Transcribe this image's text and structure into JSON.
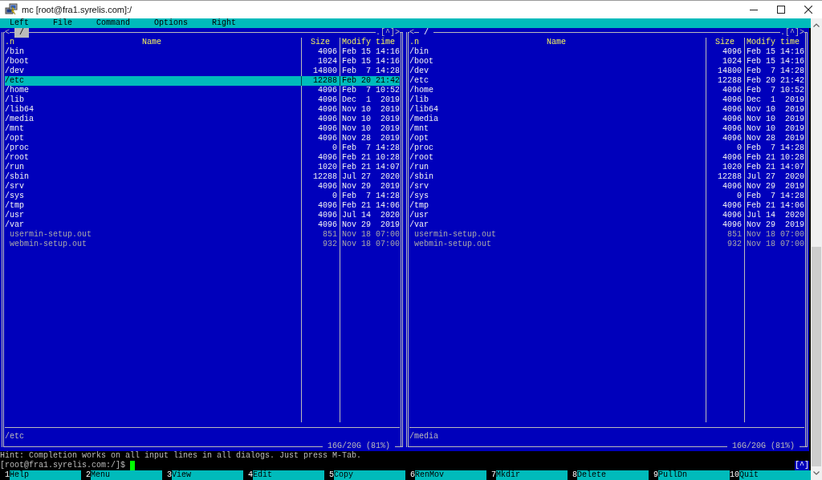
{
  "window": {
    "title": "mc [root@fra1.syrelis.com]:/"
  },
  "menu_bar": [
    "Left",
    "File",
    "Command",
    "Options",
    "Right"
  ],
  "panels": [
    {
      "active": true,
      "history_back": "<",
      "path": "/",
      "hidden_toggle": ".",
      "history_list": "[^]",
      "history_forward": ">",
      "columns": {
        "sort_indicator": ".n",
        "name": "Name",
        "size": "Size",
        "modify_time": "Modify time"
      },
      "rows": [
        {
          "kind": "directory",
          "name": "/bin",
          "size": "4096",
          "modify_time": "Feb 15 14:16",
          "selected": false
        },
        {
          "kind": "directory",
          "name": "/boot",
          "size": "1024",
          "modify_time": "Feb 15 14:16",
          "selected": false
        },
        {
          "kind": "directory",
          "name": "/dev",
          "size": "14800",
          "modify_time": "Feb  7 14:28",
          "selected": false
        },
        {
          "kind": "directory",
          "name": "/etc",
          "size": "12288",
          "modify_time": "Feb 20 21:42",
          "selected": true
        },
        {
          "kind": "directory",
          "name": "/home",
          "size": "4096",
          "modify_time": "Feb  7 10:52",
          "selected": false
        },
        {
          "kind": "directory",
          "name": "/lib",
          "size": "4096",
          "modify_time": "Dec  1  2019",
          "selected": false
        },
        {
          "kind": "directory",
          "name": "/lib64",
          "size": "4096",
          "modify_time": "Nov 10  2019",
          "selected": false
        },
        {
          "kind": "directory",
          "name": "/media",
          "size": "4096",
          "modify_time": "Nov 10  2019",
          "selected": false
        },
        {
          "kind": "directory",
          "name": "/mnt",
          "size": "4096",
          "modify_time": "Nov 10  2019",
          "selected": false
        },
        {
          "kind": "directory",
          "name": "/opt",
          "size": "4096",
          "modify_time": "Nov 28  2019",
          "selected": false
        },
        {
          "kind": "directory",
          "name": "/proc",
          "size": "0",
          "modify_time": "Feb  7 14:28",
          "selected": false
        },
        {
          "kind": "directory",
          "name": "/root",
          "size": "4096",
          "modify_time": "Feb 21 10:28",
          "selected": false
        },
        {
          "kind": "directory",
          "name": "/run",
          "size": "1020",
          "modify_time": "Feb 21 14:07",
          "selected": false
        },
        {
          "kind": "directory",
          "name": "/sbin",
          "size": "12288",
          "modify_time": "Jul 27  2020",
          "selected": false
        },
        {
          "kind": "directory",
          "name": "/srv",
          "size": "4096",
          "modify_time": "Nov 29  2019",
          "selected": false
        },
        {
          "kind": "directory",
          "name": "/sys",
          "size": "0",
          "modify_time": "Feb  7 14:28",
          "selected": false
        },
        {
          "kind": "directory",
          "name": "/tmp",
          "size": "4096",
          "modify_time": "Feb 21 14:06",
          "selected": false
        },
        {
          "kind": "directory",
          "name": "/usr",
          "size": "4096",
          "modify_time": "Jul 14  2020",
          "selected": false
        },
        {
          "kind": "directory",
          "name": "/var",
          "size": "4096",
          "modify_time": "Nov 29  2019",
          "selected": false
        },
        {
          "kind": "file",
          "name": "usermin-setup.out",
          "size": "851",
          "modify_time": "Nov 18 07:00",
          "selected": false
        },
        {
          "kind": "file",
          "name": "webmin-setup.out",
          "size": "932",
          "modify_time": "Nov 18 07:00",
          "selected": false
        }
      ],
      "current_file": "/etc",
      "disk_usage": "16G/20G (81%)"
    },
    {
      "active": false,
      "history_back": "<",
      "path": "/",
      "hidden_toggle": ".",
      "history_list": "[^]",
      "history_forward": ">",
      "columns": {
        "sort_indicator": ".n",
        "name": "Name",
        "size": "Size",
        "modify_time": "Modify time"
      },
      "rows": [
        {
          "kind": "directory",
          "name": "/bin",
          "size": "4096",
          "modify_time": "Feb 15 14:16",
          "selected": false
        },
        {
          "kind": "directory",
          "name": "/boot",
          "size": "1024",
          "modify_time": "Feb 15 14:16",
          "selected": false
        },
        {
          "kind": "directory",
          "name": "/dev",
          "size": "14800",
          "modify_time": "Feb  7 14:28",
          "selected": false
        },
        {
          "kind": "directory",
          "name": "/etc",
          "size": "12288",
          "modify_time": "Feb 20 21:42",
          "selected": false
        },
        {
          "kind": "directory",
          "name": "/home",
          "size": "4096",
          "modify_time": "Feb  7 10:52",
          "selected": false
        },
        {
          "kind": "directory",
          "name": "/lib",
          "size": "4096",
          "modify_time": "Dec  1  2019",
          "selected": false
        },
        {
          "kind": "directory",
          "name": "/lib64",
          "size": "4096",
          "modify_time": "Nov 10  2019",
          "selected": false
        },
        {
          "kind": "directory",
          "name": "/media",
          "size": "4096",
          "modify_time": "Nov 10  2019",
          "selected": false
        },
        {
          "kind": "directory",
          "name": "/mnt",
          "size": "4096",
          "modify_time": "Nov 10  2019",
          "selected": false
        },
        {
          "kind": "directory",
          "name": "/opt",
          "size": "4096",
          "modify_time": "Nov 28  2019",
          "selected": false
        },
        {
          "kind": "directory",
          "name": "/proc",
          "size": "0",
          "modify_time": "Feb  7 14:28",
          "selected": false
        },
        {
          "kind": "directory",
          "name": "/root",
          "size": "4096",
          "modify_time": "Feb 21 10:28",
          "selected": false
        },
        {
          "kind": "directory",
          "name": "/run",
          "size": "1020",
          "modify_time": "Feb 21 14:07",
          "selected": false
        },
        {
          "kind": "directory",
          "name": "/sbin",
          "size": "12288",
          "modify_time": "Jul 27  2020",
          "selected": false
        },
        {
          "kind": "directory",
          "name": "/srv",
          "size": "4096",
          "modify_time": "Nov 29  2019",
          "selected": false
        },
        {
          "kind": "directory",
          "name": "/sys",
          "size": "0",
          "modify_time": "Feb  7 14:28",
          "selected": false
        },
        {
          "kind": "directory",
          "name": "/tmp",
          "size": "4096",
          "modify_time": "Feb 21 14:06",
          "selected": false
        },
        {
          "kind": "directory",
          "name": "/usr",
          "size": "4096",
          "modify_time": "Jul 14  2020",
          "selected": false
        },
        {
          "kind": "directory",
          "name": "/var",
          "size": "4096",
          "modify_time": "Nov 29  2019",
          "selected": false
        },
        {
          "kind": "file",
          "name": "usermin-setup.out",
          "size": "851",
          "modify_time": "Nov 18 07:00",
          "selected": false
        },
        {
          "kind": "file",
          "name": "webmin-setup.out",
          "size": "932",
          "modify_time": "Nov 18 07:00",
          "selected": false
        }
      ],
      "current_file": "/media",
      "disk_usage": "16G/20G (81%)"
    }
  ],
  "hint": "Hint: Completion works on all input lines in all dialogs. Just press M-Tab.",
  "command_line": {
    "prompt": "[root@fra1.syrelis.com:/]$",
    "history_button": "[^]"
  },
  "function_keys": [
    {
      "number": "1",
      "label": "Help"
    },
    {
      "number": "2",
      "label": "Menu"
    },
    {
      "number": "3",
      "label": "View"
    },
    {
      "number": "4",
      "label": "Edit"
    },
    {
      "number": "5",
      "label": "Copy"
    },
    {
      "number": "6",
      "label": "RenMov"
    },
    {
      "number": "7",
      "label": "Mkdir"
    },
    {
      "number": "8",
      "label": "Delete"
    },
    {
      "number": "9",
      "label": "PullDn"
    },
    {
      "number": "10",
      "label": "Quit"
    }
  ]
}
